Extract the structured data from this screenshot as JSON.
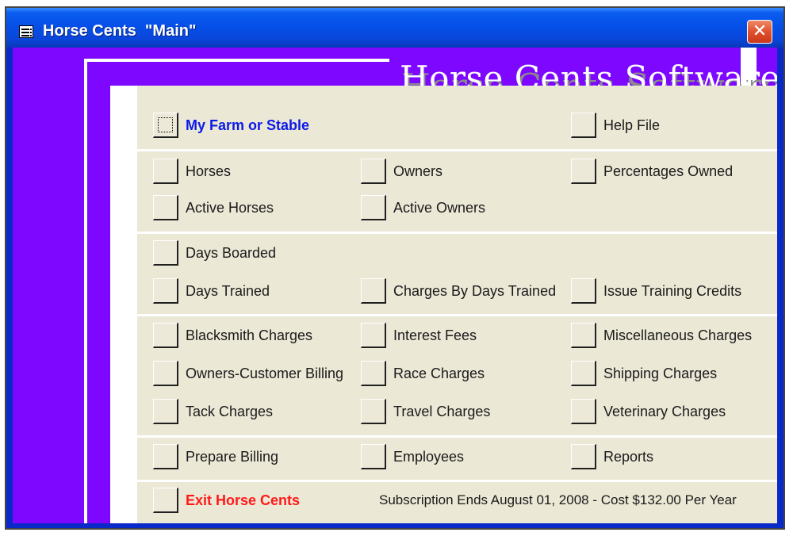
{
  "window": {
    "title": "Horse Cents  \"Main\"",
    "close_glyph": "✕"
  },
  "logo": "Horse Cents Software",
  "menu": {
    "my_farm": "My Farm or Stable",
    "help_file": "Help File",
    "horses": "Horses",
    "owners": "Owners",
    "percentages_owned": "Percentages Owned",
    "active_horses": "Active Horses",
    "active_owners": "Active Owners",
    "days_boarded": "Days Boarded",
    "days_trained": "Days Trained",
    "charges_by_days_trained": "Charges By Days Trained",
    "issue_training_credits": "Issue Training Credits",
    "blacksmith_charges": "Blacksmith Charges",
    "interest_fees": "Interest Fees",
    "miscellaneous_charges": "Miscellaneous Charges",
    "owners_customer_billing": "Owners-Customer Billing",
    "race_charges": "Race Charges",
    "shipping_charges": "Shipping Charges",
    "tack_charges": "Tack Charges",
    "travel_charges": "Travel Charges",
    "veterinary_charges": "Veterinary Charges",
    "prepare_billing": "Prepare Billing",
    "employees": "Employees",
    "reports": "Reports",
    "exit": "Exit Horse Cents"
  },
  "subscription": "Subscription Ends August 01, 2008 - Cost $132.00 Per Year",
  "colors": {
    "client_bg": "#7d07ff",
    "panel_bg": "#ece8d6",
    "title_bar": "#0550e8",
    "link_blue": "#0c1ae8",
    "exit_red": "#ff1a1a"
  }
}
